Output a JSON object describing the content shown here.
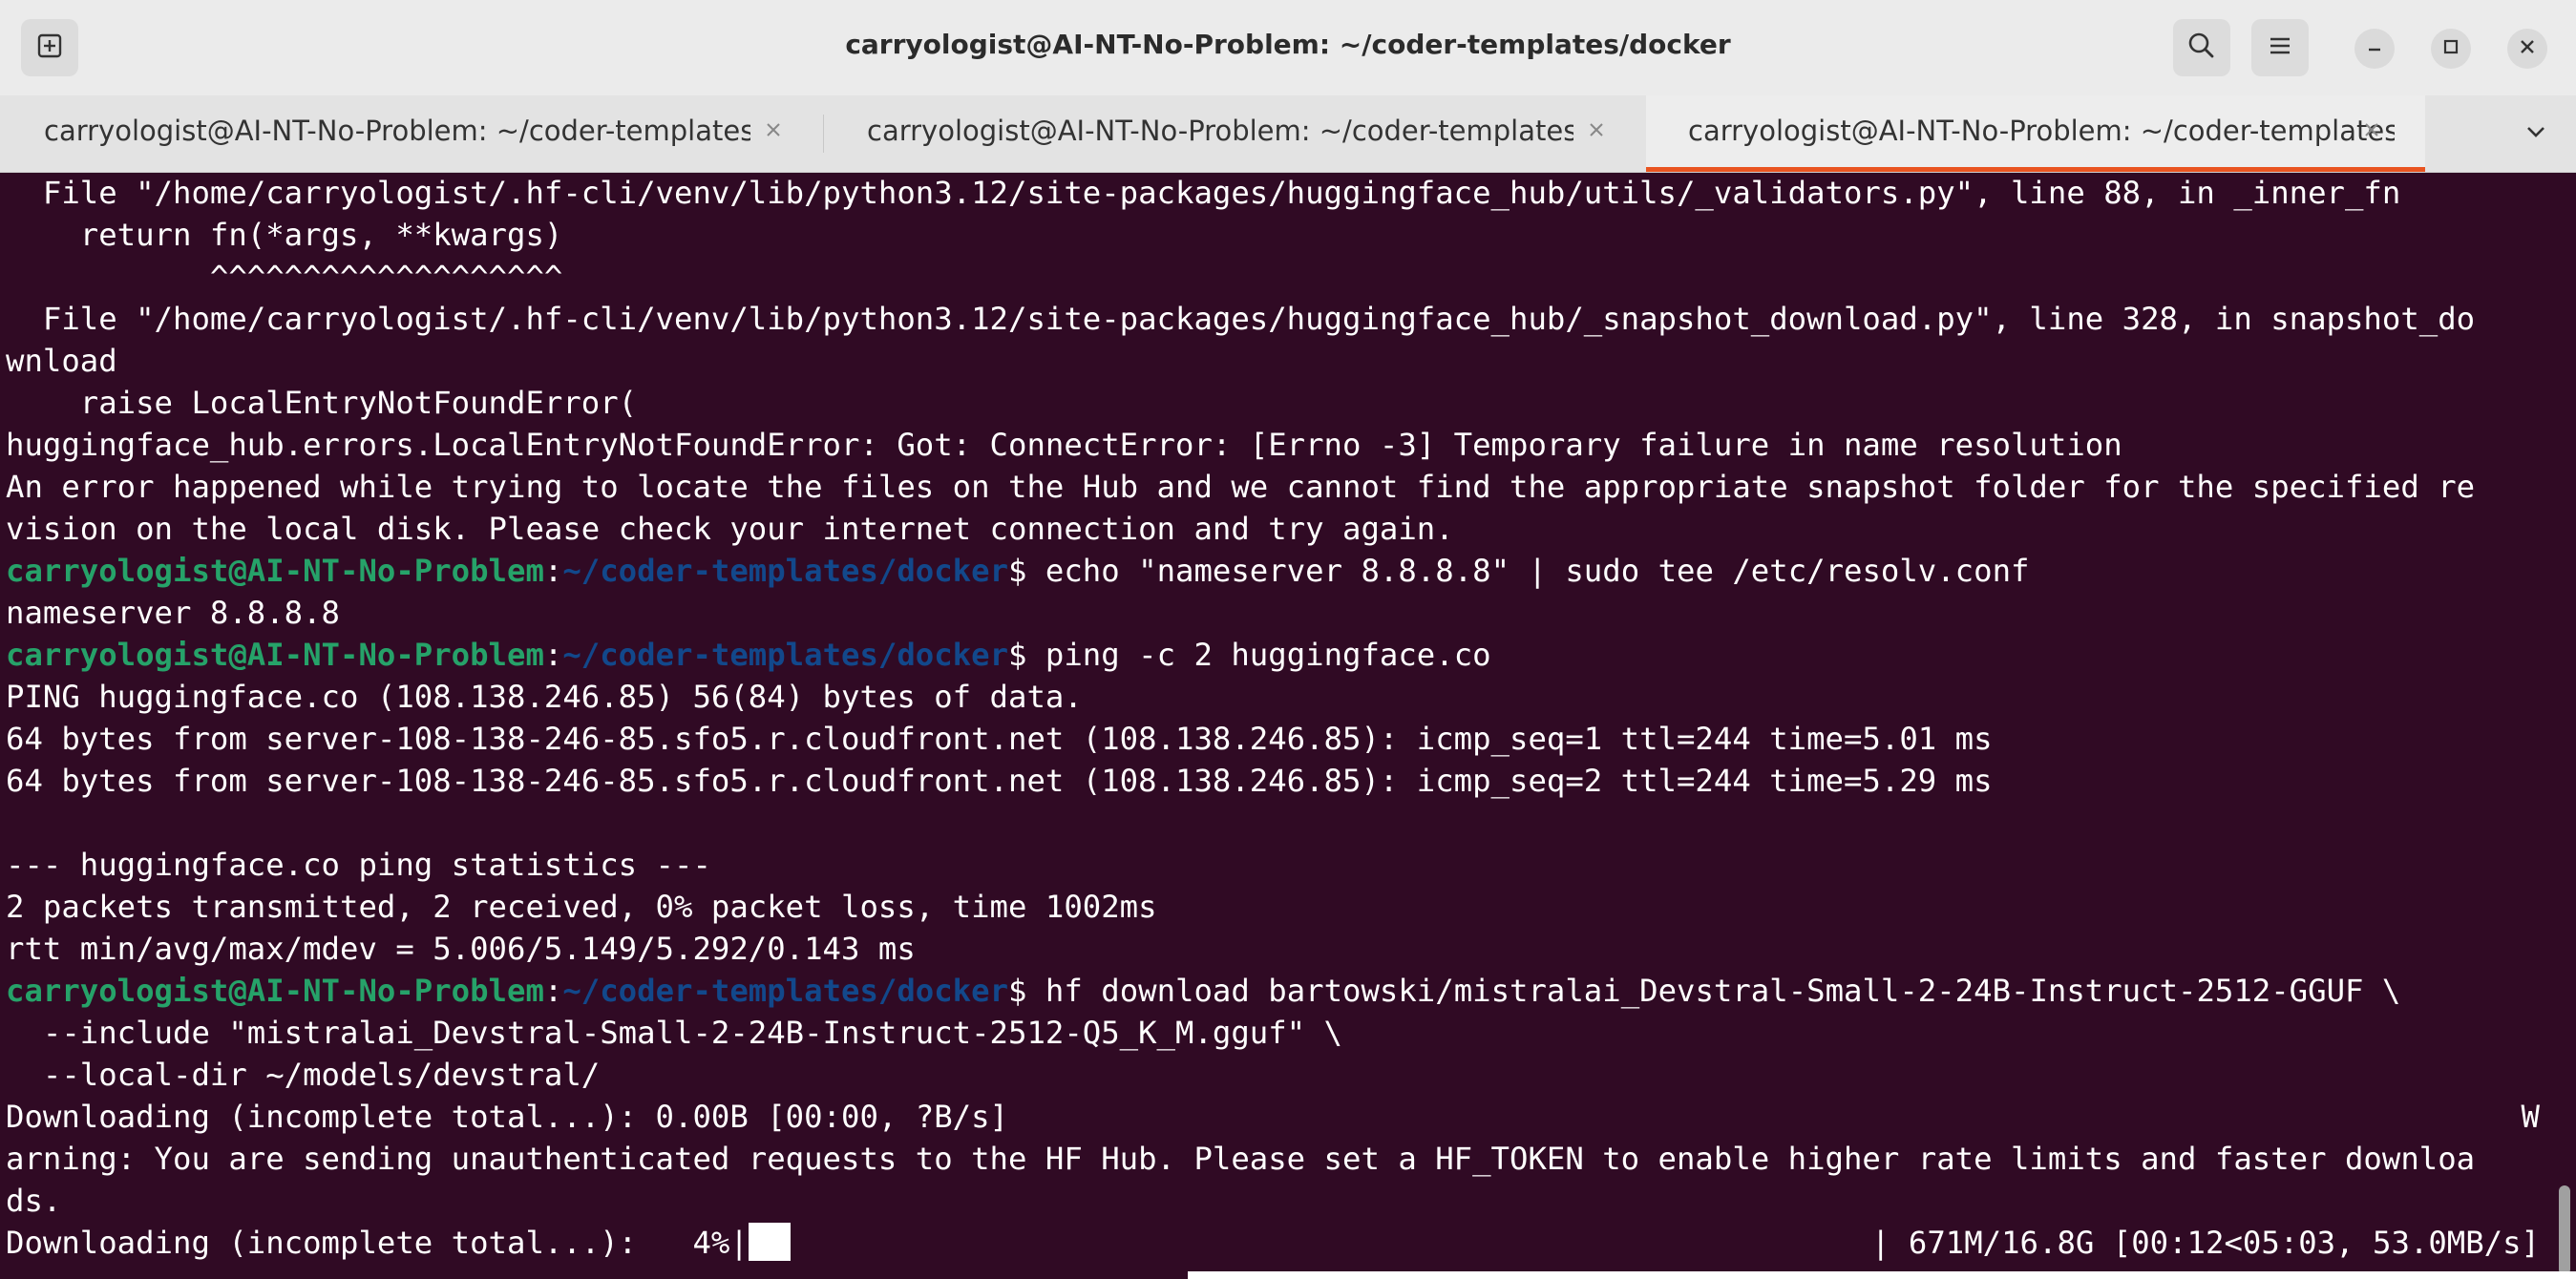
{
  "window": {
    "title": "carryologist@AI-NT-No-Problem: ~/coder-templates/docker"
  },
  "titlebar": {
    "new_tab_icon": "new-tab-icon",
    "search_icon": "search-icon",
    "menu_icon": "hamburger-menu-icon",
    "minimize_icon": "minimize-icon",
    "maximize_icon": "maximize-icon",
    "close_icon": "close-icon"
  },
  "tabs": [
    {
      "label": "carryologist@AI-NT-No-Problem: ~/coder-templates/…",
      "active": false
    },
    {
      "label": "carryologist@AI-NT-No-Problem: ~/coder-templates/…",
      "active": false
    },
    {
      "label": "carryologist@AI-NT-No-Problem: ~/coder-templates/…",
      "active": true
    }
  ],
  "colors": {
    "terminal_bg": "#300a24",
    "prompt_user": "#26a269",
    "prompt_path": "#12488b",
    "active_tab_accent": "#e95420"
  },
  "terminal": {
    "prompt": {
      "user_host": "carryologist@AI-NT-No-Problem",
      "separator": ":",
      "path": "~/coder-templates/docker",
      "symbol": "$"
    },
    "lines": [
      "  File \"/home/carryologist/.hf-cli/venv/lib/python3.12/site-packages/huggingface_hub/utils/_validators.py\", line 88, in _inner_fn",
      "    return fn(*args, **kwargs)",
      "           ^^^^^^^^^^^^^^^^^^^",
      "  File \"/home/carryologist/.hf-cli/venv/lib/python3.12/site-packages/huggingface_hub/_snapshot_download.py\", line 328, in snapshot_do",
      "wnload",
      "    raise LocalEntryNotFoundError(",
      "huggingface_hub.errors.LocalEntryNotFoundError: Got: ConnectError: [Errno -3] Temporary failure in name resolution",
      "An error happened while trying to locate the files on the Hub and we cannot find the appropriate snapshot folder for the specified re",
      "vision on the local disk. Please check your internet connection and try again."
    ],
    "cmd1": " echo \"nameserver 8.8.8.8\" | sudo tee /etc/resolv.conf",
    "out1": [
      "nameserver 8.8.8.8"
    ],
    "cmd2": " ping -c 2 huggingface.co",
    "out2": [
      "PING huggingface.co (108.138.246.85) 56(84) bytes of data.",
      "64 bytes from server-108-138-246-85.sfo5.r.cloudfront.net (108.138.246.85): icmp_seq=1 ttl=244 time=5.01 ms",
      "64 bytes from server-108-138-246-85.sfo5.r.cloudfront.net (108.138.246.85): icmp_seq=2 ttl=244 time=5.29 ms",
      "",
      "--- huggingface.co ping statistics ---",
      "2 packets transmitted, 2 received, 0% packet loss, time 1002ms",
      "rtt min/avg/max/mdev = 5.006/5.149/5.292/0.143 ms"
    ],
    "cmd3": " hf download bartowski/mistralai_Devstral-Small-2-24B-Instruct-2512-GGUF \\",
    "out3": [
      "  --include \"mistralai_Devstral-Small-2-24B-Instruct-2512-Q5_K_M.gguf\" \\",
      "  --local-dir ~/models/devstral/"
    ],
    "download_line1_left": "Downloading (incomplete total...): 0.00B [00:00, ?B/s]",
    "download_line1_right": "W",
    "warning_lines": [
      "arning: You are sending unauthenticated requests to the HF Hub. Please set a HF_TOKEN to enable higher rate limits and faster downloa",
      "ds."
    ],
    "progress_left": "Downloading (incomplete total...):   4%|",
    "progress_right": "| 671M/16.8G [00:12<05:03, 53.0MB/s]",
    "progress_percent": 4
  }
}
